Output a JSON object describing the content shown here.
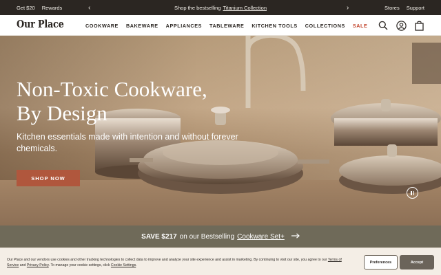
{
  "topbar": {
    "left_links": [
      "Get $20",
      "Rewards"
    ],
    "promo_prefix": "Shop the bestselling",
    "promo_link": "Titanium Collection",
    "prev_arrow": "‹",
    "next_arrow": "›",
    "right_links": [
      "Stores",
      "Support"
    ]
  },
  "header": {
    "logo": "Our Place",
    "nav": [
      "COOKWARE",
      "BAKEWARE",
      "APPLIANCES",
      "TABLEWARE",
      "KITCHEN TOOLS",
      "COLLECTIONS",
      "SALE"
    ],
    "icons": [
      "search-icon",
      "account-icon",
      "bag-icon"
    ],
    "sale_color": "#c2442b"
  },
  "hero": {
    "headline_line1": "Non-Toxic Cookware,",
    "headline_line2": "By Design",
    "subtext": "Kitchen essentials made with intention and without forever chemicals.",
    "cta": "SHOP NOW",
    "cta_color": "#b0573d",
    "pause_icon": "pause-icon"
  },
  "promo_band": {
    "amount": "SAVE $217",
    "text": "on our Bestselling",
    "link": "Cookware Set+",
    "arrow": "→",
    "background": "#6f6a59"
  },
  "cookie": {
    "text_1": "Our Place and our vendors use cookies and other tracking technologies to collect data to improve and analyze your site experience and assist in marketing. By continuing to visit our site, you agree to our ",
    "terms_link": "Terms of Service",
    "text_2": " and ",
    "privacy_link": "Privacy Policy",
    "text_3": ". To manage your cookie settings, click ",
    "settings_link": "Cookie Settings",
    "text_4": ".",
    "preferences_label": "Preferences",
    "accept_label": "Accept"
  }
}
